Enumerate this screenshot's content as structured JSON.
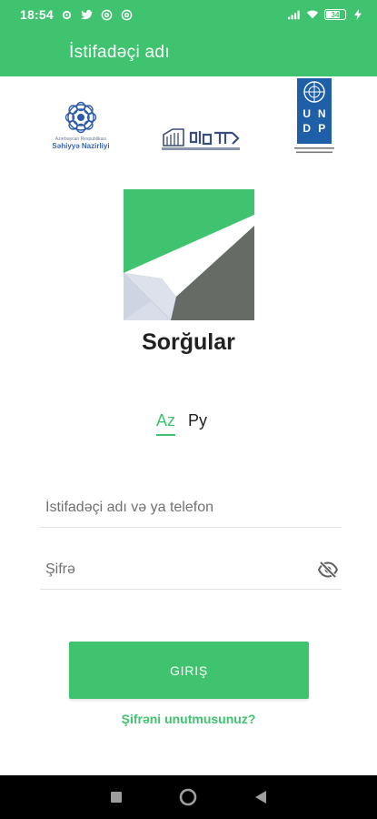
{
  "status_bar": {
    "time": "18:54",
    "battery": "34",
    "icons": [
      "settings-gear-icon",
      "twitter-icon",
      "at-sign-icon",
      "at-sign-icon",
      "signal-icon",
      "wifi-icon",
      "battery-icon",
      "charging-icon"
    ]
  },
  "app_bar": {
    "title": "İstifadəçi adı"
  },
  "partners": {
    "moh_line1": "Azərbaycan Respublikası",
    "moh_line2": "Səhiyyə Nazirliyi",
    "undp_letters": [
      "U",
      "N",
      "D",
      "P"
    ]
  },
  "app": {
    "name": "Sorğular"
  },
  "language": {
    "options": [
      "Az",
      "Ру"
    ],
    "selected": "Az"
  },
  "form": {
    "username_placeholder": "İstifadəçi adı və ya telefon",
    "password_placeholder": "Şifrə",
    "login_label": "GIRIŞ",
    "forgot_label": "Şifrəni unutmusunuz?"
  },
  "colors": {
    "accent": "#3fc36f",
    "logo_dark": "#666b66",
    "logo_light": "#d7dbe8",
    "undp_blue": "#1f5fa8"
  },
  "nav": {
    "icons": [
      "recent-apps-icon",
      "home-icon",
      "back-icon"
    ]
  }
}
